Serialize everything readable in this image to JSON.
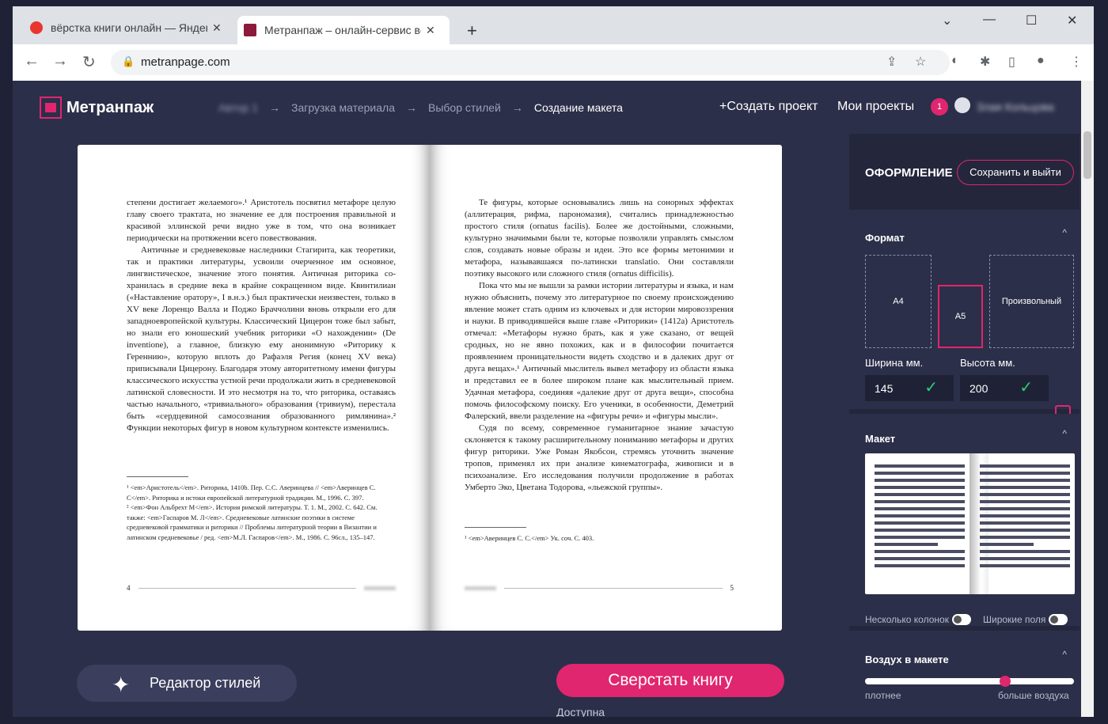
{
  "browser": {
    "tabs": [
      {
        "title": "вёрстка книги онлайн — Яндекс",
        "favicon_color": "#e8352d"
      },
      {
        "title": "Метранпаж – онлайн-сервис вёрстки",
        "favicon_color": "#8b1a3b"
      }
    ],
    "new_tab": "+",
    "url": "metranpage.com",
    "window_controls": {
      "chevron": "⌄",
      "min": "—",
      "max": "☐",
      "close": "✕"
    }
  },
  "app": {
    "logo_text": "Метранпаж",
    "breadcrumbs": {
      "step1": "Автор 1",
      "sep": "→",
      "step2": "Загрузка материала",
      "step3": "Выбор стилей",
      "step4": "Создание макета"
    },
    "nav": {
      "create": "+Создать проект",
      "projects": "Мои проекты",
      "badge": "1",
      "user": "Злая Кольцова"
    },
    "book": {
      "left": {
        "paragraphs": [
          "степени достигает желаемого».¹ Аристотель посвятил метафоре целую главу своего трактата, но значение ее для построения правильной и красивой эллинской речи видно уже в том, что она возникает периодически на протяжении всего повествования.",
          "Античные и средневековые наследники Стагирита, как теоре­тики, так и практики литературы, усвоили очерченное им основное, лингвистическое, значение этого понятия. Античная риторика со­хранилась в средние века в крайне сокращенном виде. Квинтилиан («Наставление оратору», I в.н.э.) был практически неизвестен, только в XV веке Лоренцо Валла и Поджо Браччолини вновь открыли его для западноевропейской культуры. Классический Цицерон тоже был забыт, но знали его юношеский учебник риторики «О нахожде­нии» (De inventione), а главное, близкую ему анонимную «Риторику к Гереннию», которую вплоть до Рафаэля Регия (конец XV века) приписывали Цицерону. Благодаря этому авторитетному имени фигуры классического искусства устной речи продолжали жить в средневековой латинской словесности. И это несмотря на то, что риторика, оставаясь частью начального, «тривиального» образования (тривиум), перестала быть «сердцевиной самосознания образован­ного римлянина».² Функции некоторых фигур в новом культурном контексте изменились."
        ],
        "footnotes": [
          "¹ <em>Аристотель</em>. Риторика, 1410b. Пер. С.С. Аверинцева // <em>Аверинцев С. С</em>. Риторика и истоки европейской литературной традиции. М., 1996. С. 397.",
          "² <em>Фон Альбрехт М</em>. История римской литературы. Т. 1. М., 2002. С. 642. См. также: <em>Гаспаров М. Л</em>. Средневековые латинские поэтики в системе средневековой грамматики и риторики // Проблемы литературной теории в Византии и латинском средневековье / ред. <em>М.Л. Гаспаров</em>. М., 1986. С. 96сл., 135–147."
        ],
        "page_num": "4"
      },
      "right": {
        "paragraphs": [
          "Те фигуры, которые основывались лишь на сонорных эффектах (аллитерация, рифма, парономазия), считались принадлежностью простого стиля (ornatus facilis). Более же достойными, сложными, культурно значимыми были те, которые позволяли управлять смыс­лом слов, создавать новые образы и идеи. Это все формы метонимии и метафора, называвшаяся по-латински translatio. Они составляли поэтику высокого или сложного стиля (ornatus difficilis).",
          "Пока что мы не вышли за рамки истории литературы и языка, и нам нужно объяснить, почему это литературное по своему проис­хождению явление может стать одним из ключевых и для истории мировоззрения и науки. В приводившейся выше главе «Риторики» (1412a) Аристотель отмечал: «Метафоры нужно брать, как я уже сказано, от вещей сродных, но не явно похожих, как и в филосо­фии почитается проявлением проницательности видеть сходство и в далеких друг от друга вещах».¹ Античный мыслитель вывел ме­тафору из области языка и представил ее в более широком плане как мыслительный прием. Удачная метафора, соединяя «далекие друг от друга вещи», способна помочь философскому поиску. Его ученики, в особенности, Деметрий Фалерский, ввели разделение на «фигуры речи» и «фигуры мысли».",
          "Судя по всему, современное гуманитарное знание зачастую склоняется к такому расширительному пониманию метафоры и других фигур риторики. Уже Роман Якобсон, стремясь уточнить значение тропов, применял их при анализе кинематографа, живо­писи и в психоанализе. Его исследования получили продолжение в работах Умберто Эко, Цветана Тодорова, «льежской группы»."
        ],
        "footnotes": [
          "¹ <em>Аверинцев С. С.</em> Ук. соч. С. 403."
        ],
        "page_num": "5"
      }
    },
    "styles_editor": "Редактор стилей",
    "make_book": "Сверстать книгу",
    "available": "Доступна"
  },
  "panel": {
    "title": "ОФОРМЛЕНИЕ",
    "save": "Сохранить и выйти",
    "format": {
      "header": "Формат",
      "options": [
        "A4",
        "A5",
        "Произвольный"
      ],
      "selected": "A5",
      "width_label": "Ширина мм.",
      "height_label": "Высота мм.",
      "width": "145",
      "height": "200",
      "ok": "✓"
    },
    "layout": {
      "header": "Макет",
      "multi_columns": "Несколько колонок",
      "wide_margins": "Широкие поля"
    },
    "air": {
      "header": "Воздух в макете",
      "min_label": "плотнее",
      "max_label": "больше воздуха",
      "level": 0.67
    },
    "caret": "^"
  },
  "colors": {
    "accent": "#e0266f",
    "bg": "#2c2f49",
    "ok": "#2ecc71"
  }
}
